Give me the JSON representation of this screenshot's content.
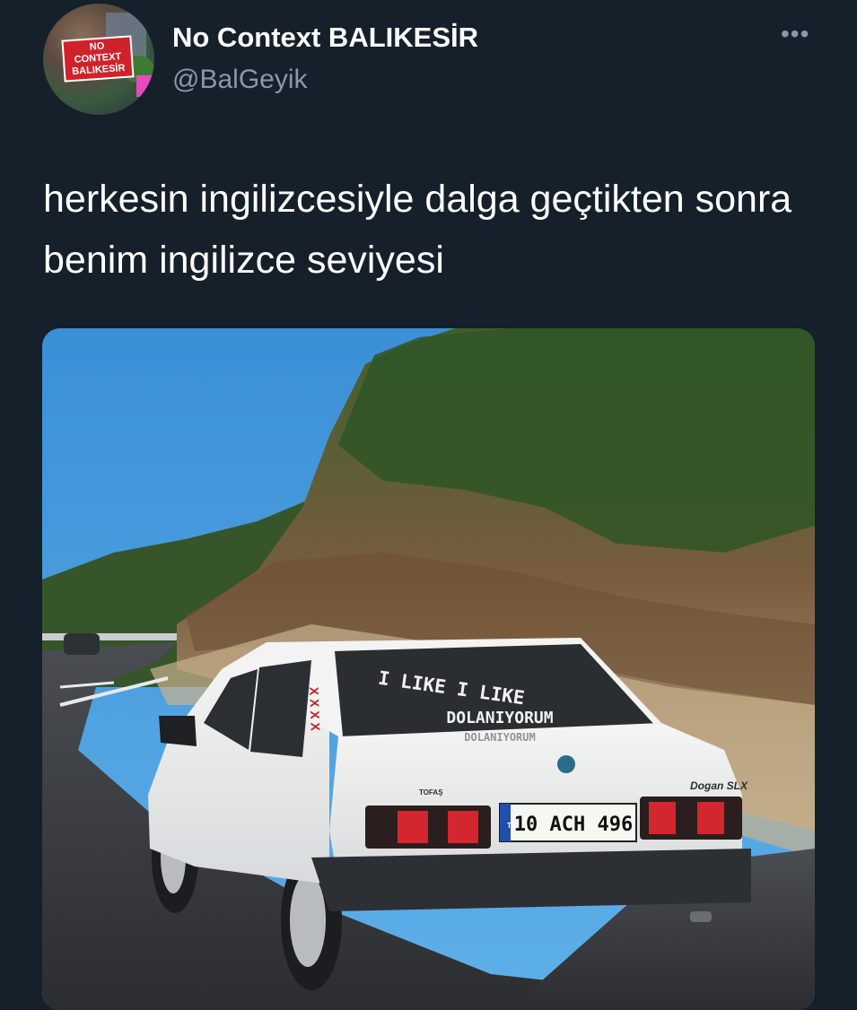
{
  "account": {
    "display_name": "No Context BALIKESİR",
    "handle": "@BalGeyik",
    "avatar_badge": [
      "NO",
      "CONTEXT",
      "BALIKESİR"
    ]
  },
  "more_label": "•••",
  "tweet_text": "herkesin ingilizcesiyle dalga geçtikten sonra benim ingilizce seviyesi",
  "photo": {
    "window_text_line1": "I LIKE I LIKE",
    "window_text_line2": "DOLANIYORUM",
    "window_text_line3": "DOLANIYORUM",
    "plate": "10 ACH 496",
    "plate_tr": "TR",
    "model_badge": "Dogan SLX",
    "trim_badge": "TOFAŞ"
  },
  "colors": {
    "background": "#15202b",
    "secondary_text": "#8b98a5"
  }
}
